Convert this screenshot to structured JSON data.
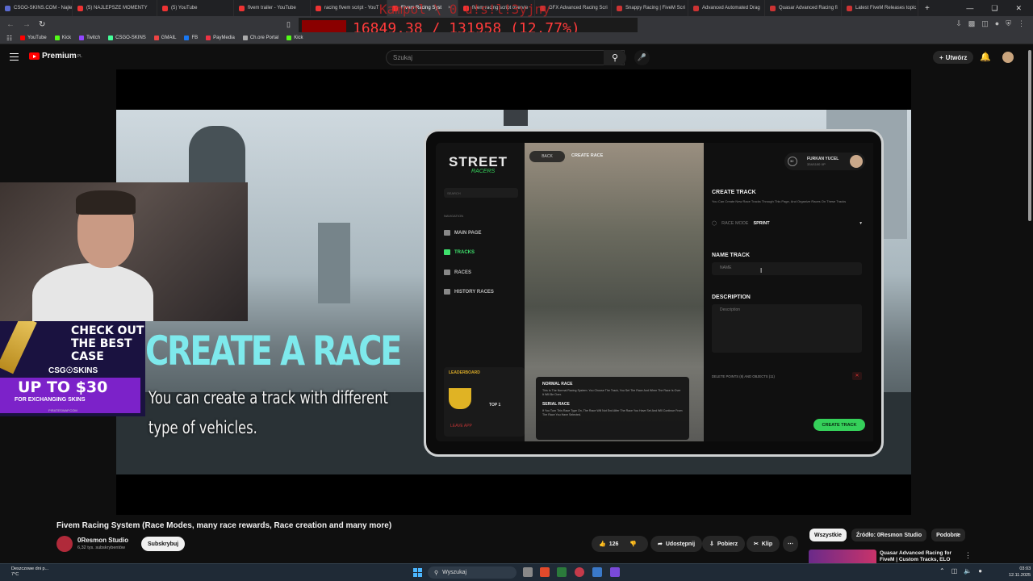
{
  "browser": {
    "tabs": [
      {
        "label": "CSGO-SKINS.COM - Najlep"
      },
      {
        "label": "(5) NAJLEPSZE MOMENTY"
      },
      {
        "label": "(5) YouTube"
      },
      {
        "label": "fivem trailer - YouTube"
      },
      {
        "label": "racing fivem script - YouT"
      },
      {
        "label": "Fivem Racing Syst",
        "active": true
      },
      {
        "label": "fivem racing script overvie"
      },
      {
        "label": "GFX Advanced Racing Scri"
      },
      {
        "label": "Snappy Racing | FiveM Scri"
      },
      {
        "label": "Advanced Automated Drag"
      },
      {
        "label": "Quasar Advanced Racing fi"
      },
      {
        "label": "Latest FiveM Releases topic"
      }
    ],
    "new_tab": "+",
    "bookmarks": [
      "YouTube",
      "Kick",
      "Twitch",
      "CSGO-SKINS",
      "GMAIL",
      "FB",
      "PayMedia",
      "Ch.ore Portal",
      "Kick"
    ]
  },
  "stream_overlay": {
    "counter": "16849.38 / 131958 (12.77%)",
    "ghost": "Kampol \\ 0 u!s!l!3yjny"
  },
  "youtube": {
    "logo": "Premium",
    "region": "PL",
    "search_placeholder": "Szukaj",
    "create_label": "Utwórz"
  },
  "video": {
    "headline": "CREATE A RACE",
    "subline": "You can create a track with different type of vehicles.",
    "tablet": {
      "brand": "STREET",
      "brand_sub": "RACERS",
      "search": "SEARCH",
      "nav_label": "NAVIGATION",
      "nav": [
        "MAIN PAGE",
        "TRACKS",
        "RACES",
        "HISTORY RACES"
      ],
      "active_nav": 1,
      "leaderboard": "LEADERBOARD",
      "top": "TOP 1",
      "leave": "LEAVE APP",
      "back": "BACK",
      "create_race": "CREATE RACE",
      "user_name": "FURKAN YUCEL",
      "user_xp": "334/1100 XP",
      "user_level": "32",
      "normal_h": "NORMAL RACE",
      "normal_p": "This Is The Normal Racing System. You Choose The Track, You Set The Race And When The Race Is Over It Will Be Over.",
      "serial_h": "SERIAL RACE",
      "serial_p": "If You Turn This Race Type On, The Race Will Not End After The Race You Have Set And Will Continue From The Race You Have Selected.",
      "create_track_h": "CREATE TRACK",
      "create_track_p": "You Can Create New Race Tracks Through This Page, And Organize Races On These Tracks",
      "race_mode_label": "RACE MODE",
      "race_mode_value": "SPRINT",
      "name_track_h": "NAME TRACK",
      "name_placeholder": "NAME",
      "description_h": "DESCRIPTION",
      "description_placeholder": "Description",
      "delete_points": "DELETE POINTS (8) AND OBJECTS (11)",
      "create_track_btn": "CREATE TRACK"
    },
    "ad": {
      "check": "CHECK OUT THE BEST CASE",
      "brand": "CSG☉SKINS",
      "offer": "UP TO $30",
      "offer_sub": "FOR EXCHANGING SKINS",
      "url": "PIRATESWAP.COM"
    }
  },
  "below": {
    "title": "Fivem Racing System (Race Modes, many race rewards, Race creation and many more)",
    "channel": "0Resmon Studio",
    "subs": "6,32 tys. subskrybentów",
    "subscribe": "Subskrybuj",
    "likes": "126",
    "share": "Udostępnij",
    "download": "Pobierz",
    "clip": "Klip",
    "chips": [
      "Wszystkie",
      "Źródło: 0Resmon Studio",
      "Podobne"
    ],
    "rec_title": "Quasar Advanced Racing for FiveM | Custom Tracks, ELO"
  },
  "taskbar": {
    "weather_title": "Deszczowe dni p...",
    "weather_temp": "7°C",
    "search": "Wyszukaj",
    "time": "03:03",
    "date": "12.11.2025"
  }
}
